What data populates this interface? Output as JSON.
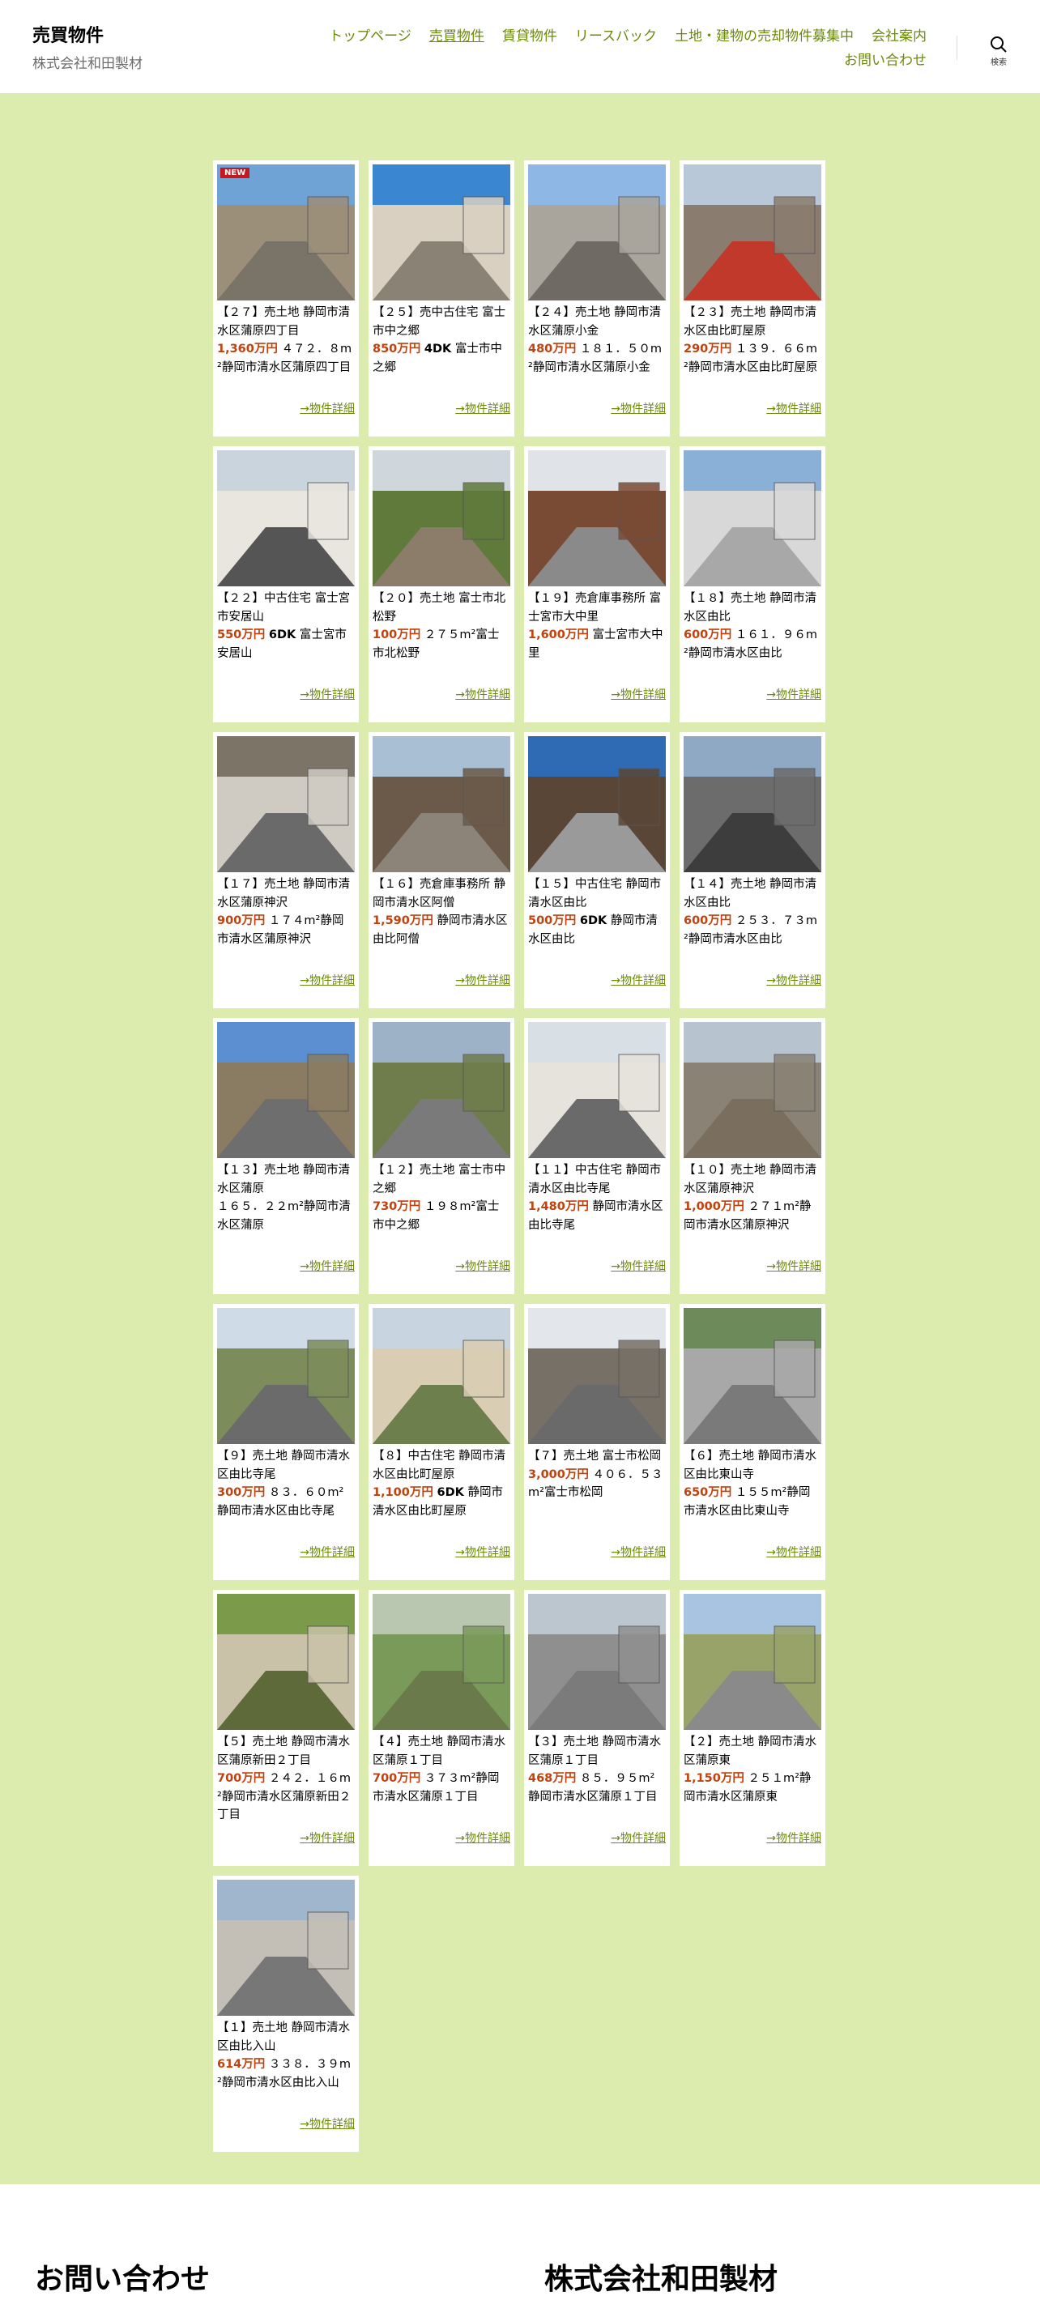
{
  "header": {
    "site_title": "売買物件",
    "site_description": "株式会社和田製材",
    "nav": [
      "トップページ",
      "売買物件",
      "賃貸物件",
      "リースバック",
      "土地・建物の売却物件募集中",
      "会社案内",
      "お問い合わせ"
    ],
    "search_label": "検索"
  },
  "colors": {
    "background": "#dcebae",
    "link": "#6b8a0a",
    "price": "#c2410c",
    "badge": "#c8161d"
  },
  "new_badge": "NEW",
  "detail_label": "→物件詳細",
  "listings": [
    {
      "title": "【２７】売土地 静岡市清水区蒲原四丁目",
      "price": "1,360万円",
      "rest": "４７２．８m²静岡市清水区蒲原四丁目",
      "badge": true
    },
    {
      "title": "【２５】売中古住宅 富士市中之郷",
      "price": "850万円",
      "rooms": "4DK",
      "rest": "富士市中之郷"
    },
    {
      "title": "【２４】売土地 静岡市清水区蒲原小金",
      "price": "480万円",
      "rest": "１８１．５０m²静岡市清水区蒲原小金"
    },
    {
      "title": "【２３】売土地 静岡市清水区由比町屋原",
      "price": "290万円",
      "rest": "１３９．６６m²静岡市清水区由比町屋原"
    },
    {
      "title": "【２２】中古住宅 富士宮市安居山",
      "price": "550万円",
      "rooms": "6DK",
      "rest": "富士宮市安居山"
    },
    {
      "title": "【２０】売土地 富士市北松野",
      "price": "100万円",
      "rest": "２７５m²富士市北松野"
    },
    {
      "title": "【１９】売倉庫事務所 富士宮市大中里",
      "price": "1,600万円",
      "rest": "富士宮市大中里"
    },
    {
      "title": "【１８】売土地 静岡市清水区由比",
      "price": "600万円",
      "rest": "１６１．９６m²静岡市清水区由比"
    },
    {
      "title": "【１７】売土地 静岡市清水区蒲原神沢",
      "price": "900万円",
      "rest": "１７４m²静岡市清水区蒲原神沢"
    },
    {
      "title": "【１６】売倉庫事務所 静岡市清水区阿僧",
      "price": "1,590万円",
      "rest": "静岡市清水区由比阿僧"
    },
    {
      "title": "【１５】中古住宅 静岡市清水区由比",
      "price": "500万円",
      "rooms": "6DK",
      "rest": "静岡市清水区由比"
    },
    {
      "title": "【１４】売土地 静岡市清水区由比",
      "price": "600万円",
      "rest": "２５３．７３m²静岡市清水区由比"
    },
    {
      "title": "【１３】売土地 静岡市清水区蒲原",
      "price": "",
      "rest": "１６５．２２m²静岡市清水区蒲原"
    },
    {
      "title": "【１２】売土地 富士市中之郷",
      "price": "730万円",
      "rest": "１９８m²富士市中之郷"
    },
    {
      "title": "【１１】中古住宅 静岡市清水区由比寺尾",
      "price": "1,480万円",
      "rest": "静岡市清水区由比寺尾"
    },
    {
      "title": "【１０】売土地 静岡市清水区蒲原神沢",
      "price": "1,000万円",
      "rest": "２７１m²静岡市清水区蒲原神沢"
    },
    {
      "title": "【９】売土地 静岡市清水区由比寺尾",
      "price": "300万円",
      "rest": "８３．６０m²静岡市清水区由比寺尾"
    },
    {
      "title": "【８】中古住宅 静岡市清水区由比町屋原",
      "price": "1,100万円",
      "rooms": "6DK",
      "rest": "静岡市清水区由比町屋原"
    },
    {
      "title": "【７】売土地 富士市松岡",
      "price": "3,000万円",
      "rest": "４０６．５３m²富士市松岡"
    },
    {
      "title": "【６】売土地 静岡市清水区由比東山寺",
      "price": "650万円",
      "rest": "１５５m²静岡市清水区由比東山寺"
    },
    {
      "title": "【５】売土地 静岡市清水区蒲原新田２丁目",
      "price": "700万円",
      "rest": "２４２．１６m²静岡市清水区蒲原新田２丁目"
    },
    {
      "title": "【４】売土地 静岡市清水区蒲原１丁目",
      "price": "700万円",
      "rest": "３７３m²静岡市清水区蒲原１丁目"
    },
    {
      "title": "【３】売土地 静岡市清水区蒲原１丁目",
      "price": "468万円",
      "rest": "８５．９５m²静岡市清水区蒲原１丁目"
    },
    {
      "title": "【２】売土地 静岡市清水区蒲原東",
      "price": "1,150万円",
      "rest": "２５１m²静岡市清水区蒲原東"
    },
    {
      "title": "【１】売土地 静岡市清水区由比入山",
      "price": "614万円",
      "rest": "３３８．３９m²静岡市清水区由比入山"
    }
  ],
  "footer": {
    "contact_heading": "お問い合わせ",
    "company_heading": "株式会社和田製材"
  }
}
